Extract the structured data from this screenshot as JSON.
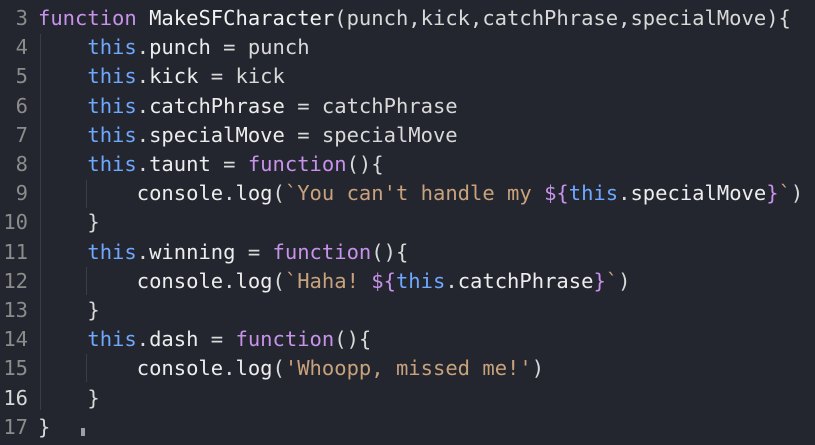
{
  "editor": {
    "lines": [
      {
        "num": "3",
        "indent": "",
        "tokens": [
          [
            "kw",
            "function "
          ],
          [
            "fn",
            "MakeSFCharacter"
          ],
          [
            "punc",
            "(punch,kick,catchPhrase,specialMove){"
          ]
        ]
      },
      {
        "num": "4",
        "indent": "    ",
        "tokens": [
          [
            "this",
            "this"
          ],
          [
            "punc",
            "."
          ],
          [
            "prop",
            "punch"
          ],
          [
            "punc",
            " = punch"
          ]
        ]
      },
      {
        "num": "5",
        "indent": "    ",
        "tokens": [
          [
            "this",
            "this"
          ],
          [
            "punc",
            "."
          ],
          [
            "prop",
            "kick"
          ],
          [
            "punc",
            " = kick"
          ]
        ]
      },
      {
        "num": "6",
        "indent": "    ",
        "tokens": [
          [
            "this",
            "this"
          ],
          [
            "punc",
            "."
          ],
          [
            "prop",
            "catchPhrase"
          ],
          [
            "punc",
            " = catchPhrase"
          ]
        ]
      },
      {
        "num": "7",
        "indent": "    ",
        "tokens": [
          [
            "this",
            "this"
          ],
          [
            "punc",
            "."
          ],
          [
            "prop",
            "specialMove"
          ],
          [
            "punc",
            " = specialMove"
          ]
        ]
      },
      {
        "num": "8",
        "indent": "    ",
        "tokens": [
          [
            "this",
            "this"
          ],
          [
            "punc",
            "."
          ],
          [
            "prop",
            "taunt"
          ],
          [
            "punc",
            " = "
          ],
          [
            "kw",
            "function"
          ],
          [
            "punc",
            "(){"
          ]
        ]
      },
      {
        "num": "9",
        "indent": "        ",
        "tokens": [
          [
            "prop",
            "console"
          ],
          [
            "punc",
            "."
          ],
          [
            "prop",
            "log"
          ],
          [
            "punc",
            "("
          ],
          [
            "str",
            "`You can't handle my "
          ],
          [
            "tmpl-var",
            "${"
          ],
          [
            "this",
            "this"
          ],
          [
            "punc",
            "."
          ],
          [
            "prop",
            "specialMove"
          ],
          [
            "tmpl-var",
            "}"
          ],
          [
            "str",
            "`"
          ],
          [
            "punc",
            ")"
          ]
        ]
      },
      {
        "num": "10",
        "indent": "    ",
        "tokens": [
          [
            "punc",
            "}"
          ]
        ]
      },
      {
        "num": "11",
        "indent": "    ",
        "tokens": [
          [
            "this",
            "this"
          ],
          [
            "punc",
            "."
          ],
          [
            "prop",
            "winning"
          ],
          [
            "punc",
            " = "
          ],
          [
            "kw",
            "function"
          ],
          [
            "punc",
            "(){"
          ]
        ]
      },
      {
        "num": "12",
        "indent": "        ",
        "tokens": [
          [
            "prop",
            "console"
          ],
          [
            "punc",
            "."
          ],
          [
            "prop",
            "log"
          ],
          [
            "punc",
            "("
          ],
          [
            "str",
            "`Haha! "
          ],
          [
            "tmpl-var",
            "${"
          ],
          [
            "this",
            "this"
          ],
          [
            "punc",
            "."
          ],
          [
            "prop",
            "catchPhrase"
          ],
          [
            "tmpl-var",
            "}"
          ],
          [
            "str",
            "`"
          ],
          [
            "punc",
            ")"
          ]
        ]
      },
      {
        "num": "13",
        "indent": "    ",
        "tokens": [
          [
            "punc",
            "}"
          ]
        ]
      },
      {
        "num": "14",
        "indent": "    ",
        "tokens": [
          [
            "this",
            "this"
          ],
          [
            "punc",
            "."
          ],
          [
            "prop",
            "dash"
          ],
          [
            "punc",
            " = "
          ],
          [
            "kw",
            "function"
          ],
          [
            "punc",
            "(){"
          ]
        ]
      },
      {
        "num": "15",
        "indent": "        ",
        "tokens": [
          [
            "prop",
            "console"
          ],
          [
            "punc",
            "."
          ],
          [
            "prop",
            "log"
          ],
          [
            "punc",
            "("
          ],
          [
            "str",
            "'Whoopp, missed me!'"
          ],
          [
            "punc",
            ")"
          ]
        ]
      },
      {
        "num": "16",
        "indent": "    ",
        "tokens": [
          [
            "punc",
            "}"
          ]
        ],
        "active": true
      },
      {
        "num": "17",
        "indent": "",
        "tokens": [
          [
            "punc",
            "}"
          ]
        ]
      }
    ]
  }
}
